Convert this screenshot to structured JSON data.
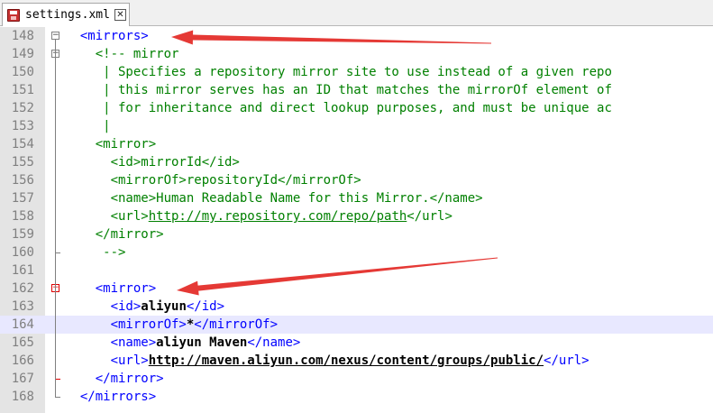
{
  "tab": {
    "filename": "settings.xml",
    "close_glyph": "✕",
    "save_icon": "floppy-disk-icon"
  },
  "annotation_color": "#e53935",
  "lines": [
    {
      "num": "148",
      "segments": [
        {
          "cls": "t",
          "text": "  <mirrors>"
        }
      ]
    },
    {
      "num": "149",
      "segments": [
        {
          "cls": "c",
          "text": "    <!-- mirror"
        }
      ]
    },
    {
      "num": "150",
      "segments": [
        {
          "cls": "c",
          "text": "     | Specifies a repository mirror site to use instead of a given repo"
        }
      ]
    },
    {
      "num": "151",
      "segments": [
        {
          "cls": "c",
          "text": "     | this mirror serves has an ID that matches the mirrorOf element of"
        }
      ]
    },
    {
      "num": "152",
      "segments": [
        {
          "cls": "c",
          "text": "     | for inheritance and direct lookup purposes, and must be unique ac"
        }
      ]
    },
    {
      "num": "153",
      "segments": [
        {
          "cls": "c",
          "text": "     |"
        }
      ]
    },
    {
      "num": "154",
      "segments": [
        {
          "cls": "c",
          "text": "    <mirror>"
        }
      ]
    },
    {
      "num": "155",
      "segments": [
        {
          "cls": "c",
          "text": "      <id>mirrorId</id>"
        }
      ]
    },
    {
      "num": "156",
      "segments": [
        {
          "cls": "c",
          "text": "      <mirrorOf>repositoryId</mirrorOf>"
        }
      ]
    },
    {
      "num": "157",
      "segments": [
        {
          "cls": "c",
          "text": "      <name>Human Readable Name for this Mirror.</name>"
        }
      ]
    },
    {
      "num": "158",
      "segments": [
        {
          "cls": "c",
          "text": "      <url>"
        },
        {
          "cls": "c underline",
          "text": "http://my.repository.com/repo/path"
        },
        {
          "cls": "c",
          "text": "</url>"
        }
      ]
    },
    {
      "num": "159",
      "segments": [
        {
          "cls": "c",
          "text": "    </mirror>"
        }
      ]
    },
    {
      "num": "160",
      "segments": [
        {
          "cls": "c",
          "text": "     -->"
        }
      ]
    },
    {
      "num": "161",
      "segments": [
        {
          "cls": "k",
          "text": ""
        }
      ]
    },
    {
      "num": "162",
      "segments": [
        {
          "cls": "t",
          "text": "    <mirror>"
        }
      ]
    },
    {
      "num": "163",
      "segments": [
        {
          "cls": "t",
          "text": "      <id>"
        },
        {
          "cls": "b",
          "text": "aliyun"
        },
        {
          "cls": "t",
          "text": "</id>"
        }
      ]
    },
    {
      "num": "164",
      "segments": [
        {
          "cls": "t",
          "text": "      <mirrorOf>"
        },
        {
          "cls": "b",
          "text": "*"
        },
        {
          "cls": "t",
          "text": "</mirrorOf>"
        }
      ]
    },
    {
      "num": "165",
      "segments": [
        {
          "cls": "t",
          "text": "      <name>"
        },
        {
          "cls": "b",
          "text": "aliyun Maven"
        },
        {
          "cls": "t",
          "text": "</name>"
        }
      ]
    },
    {
      "num": "166",
      "segments": [
        {
          "cls": "t",
          "text": "      <url>"
        },
        {
          "cls": "ub",
          "text": "http://maven.aliyun.com/nexus/content/groups/public/"
        },
        {
          "cls": "t",
          "text": "</url>"
        }
      ]
    },
    {
      "num": "167",
      "segments": [
        {
          "cls": "t",
          "text": "    </mirror>"
        }
      ]
    },
    {
      "num": "168",
      "segments": [
        {
          "cls": "t",
          "text": "  </mirrors>"
        }
      ]
    }
  ],
  "current_line": "164"
}
